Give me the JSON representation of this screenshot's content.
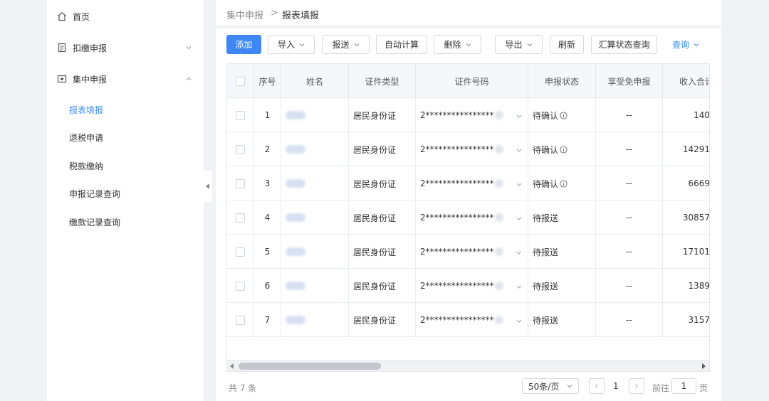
{
  "sidebar": {
    "items": [
      {
        "label": "首页",
        "icon": "home-icon"
      },
      {
        "label": "扣缴申报",
        "icon": "document-icon"
      },
      {
        "label": "集中申报",
        "icon": "box-icon"
      }
    ],
    "sub_items": [
      {
        "label": "报表填报",
        "active": true
      },
      {
        "label": "退税申请"
      },
      {
        "label": "税款缴纳"
      },
      {
        "label": "申报记录查询"
      },
      {
        "label": "缴款记录查询"
      }
    ]
  },
  "breadcrumb": {
    "parent": "集中申报",
    "separator": ">",
    "current": "报表填报"
  },
  "toolbar": {
    "add": "添加",
    "import": "导入",
    "submit": "报送",
    "auto_calc": "自动计算",
    "delete": "删除",
    "export": "导出",
    "refresh": "刷新",
    "summary_status": "汇算状态查询",
    "query": "查询"
  },
  "table": {
    "columns": [
      "序号",
      "姓名",
      "证件类型",
      "证件号码",
      "申报状态",
      "享受免申报",
      "收入合计"
    ],
    "rows": [
      {
        "no": "1",
        "id_type": "居民身份证",
        "id_no": "2****************",
        "status": "待确认",
        "exempt": "--",
        "income": "140"
      },
      {
        "no": "2",
        "id_type": "居民身份证",
        "id_no": "2****************",
        "status": "待确认",
        "exempt": "--",
        "income": "14291"
      },
      {
        "no": "3",
        "id_type": "居民身份证",
        "id_no": "2****************",
        "status": "待确认",
        "exempt": "--",
        "income": "6669"
      },
      {
        "no": "4",
        "id_type": "居民身份证",
        "id_no": "2****************",
        "status": "待报送",
        "exempt": "--",
        "income": "30857"
      },
      {
        "no": "5",
        "id_type": "居民身份证",
        "id_no": "2****************",
        "status": "待报送",
        "exempt": "--",
        "income": "17101"
      },
      {
        "no": "6",
        "id_type": "居民身份证",
        "id_no": "2****************",
        "status": "待报送",
        "exempt": "--",
        "income": "1389"
      },
      {
        "no": "7",
        "id_type": "居民身份证",
        "id_no": "2****************",
        "status": "待报送",
        "exempt": "--",
        "income": "3157"
      }
    ]
  },
  "footer": {
    "total": "共 7 条",
    "page_size": "50条/页",
    "current_page": "1",
    "goto_prefix": "前往",
    "goto_value": "1",
    "goto_suffix": "页"
  },
  "colors": {
    "accent": "#3f87f5",
    "link": "#3c8cf0"
  }
}
